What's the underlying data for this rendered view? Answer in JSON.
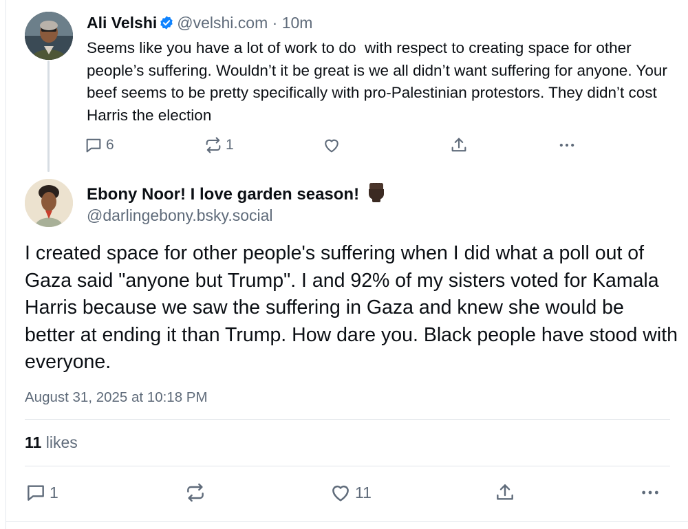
{
  "parent_post": {
    "author_name": "Ali Velshi",
    "handle": "@velshi.com",
    "separator": "·",
    "time_ago": "10m",
    "text": "Seems like you have a lot of work to do  with respect to creating space for other people’s suffering. Wouldn’t it be great is we all didn’t want suffering for anyone. Your beef seems to be pretty specifically with pro-Palestinian protestors. They didn’t cost Harris the election",
    "reply_count": "6",
    "repost_count": "1",
    "icons": {
      "verified": "verified-badge-icon",
      "reply": "reply-icon",
      "repost": "repost-icon",
      "like": "heart-icon",
      "share": "share-icon",
      "more": "more-icon"
    }
  },
  "main_post": {
    "author_name": "Ebony Noor! I love garden season!",
    "author_emoji": "raised-fist-dark-skin-tone",
    "handle": "@darlingebony.bsky.social",
    "text": "I created space for other people's suffering when I did what a poll out of Gaza said \"anyone but Trump\". I and 92% of my sisters voted for Kamala Harris because we saw the suffering in Gaza and knew she would be better at ending it than Trump. How dare you. Black people have stood with everyone.",
    "date": "August 31, 2025 at 10:18 PM",
    "likes_count": "11",
    "likes_label": "likes",
    "reply_count": "1",
    "like_count": "11"
  },
  "colors": {
    "text_primary": "#0b0f14",
    "text_secondary": "#5f6b7a",
    "verified_blue": "#1083fe",
    "divider": "#dfe3e8",
    "thread_line": "#d7dde3"
  }
}
